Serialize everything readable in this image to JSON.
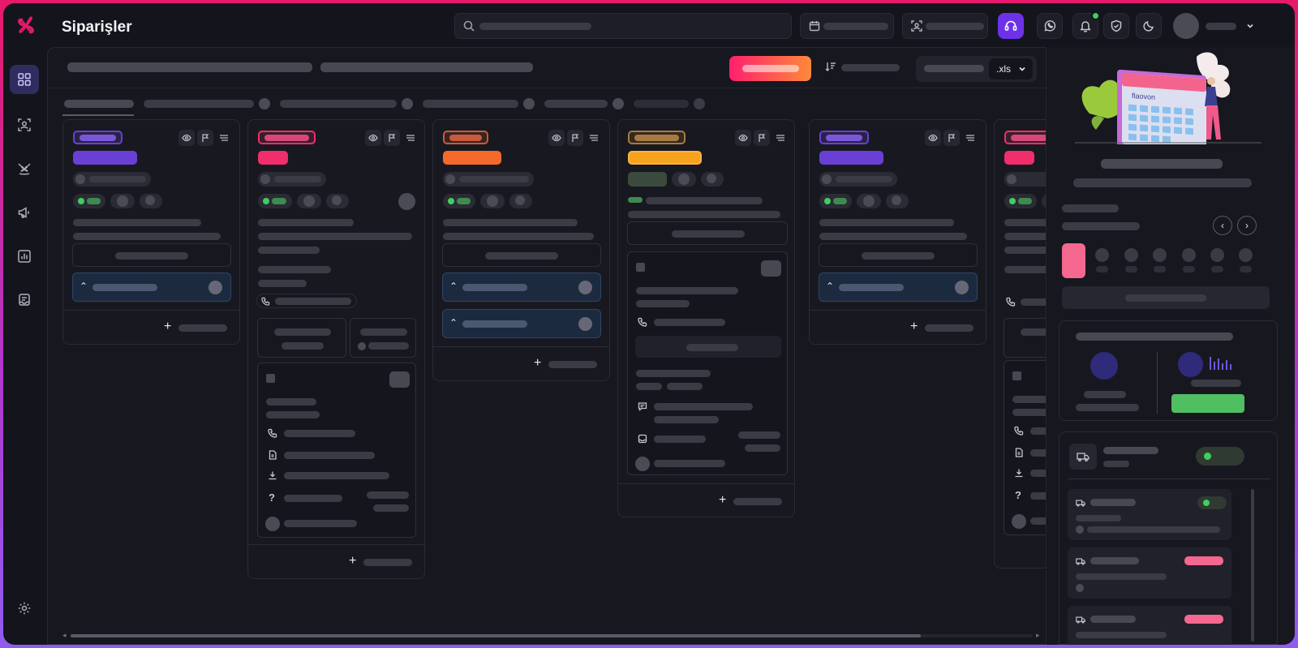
{
  "header": {
    "title": "Siparişler"
  },
  "toolbar": {
    "export_format": ".xls"
  },
  "colors": {
    "brand_pink": "#e8196a",
    "accent_purple": "#6d32e8",
    "status_green": "#3ecf5e",
    "gradient_start": "#ff1f6d",
    "gradient_end": "#ff8a3a",
    "calendar_pink": "#f4678f"
  },
  "columns": [
    {
      "chip_color": "#6a3fd6",
      "bar_color": "#7a57d9"
    },
    {
      "chip_color": "#ef2e6b",
      "bar_color": "#d4497a"
    },
    {
      "chip_color": "#f5692a",
      "bar_color": "#c95a3b"
    },
    {
      "chip_color": "#f7a21c",
      "bar_color": "#a77a44"
    },
    {
      "chip_color": "#6a3fd6",
      "bar_color": "#7a57d9"
    },
    {
      "chip_color": "#ef2e6b",
      "bar_color": "#d4497a"
    }
  ],
  "icons": {
    "logo": "flower-logo-icon",
    "search": "search-icon",
    "calendar": "calendar-icon",
    "scan": "scan-user-icon",
    "support": "headset-icon",
    "whatsapp": "whatsapp-icon",
    "bell": "bell-icon",
    "shield": "shield-icon",
    "theme": "moon-icon",
    "chevron": "chevron-down-icon",
    "sort": "sort-icon",
    "eye": "eye-icon",
    "flag": "flag-icon",
    "menu": "menu-icon",
    "phone": "phone-icon",
    "file": "file-icon",
    "download": "download-icon",
    "help": "question-icon",
    "comment": "comment-icon",
    "truck": "truck-icon",
    "settings": "gear-icon"
  },
  "illustration": {
    "brand_text": "flaovon"
  }
}
